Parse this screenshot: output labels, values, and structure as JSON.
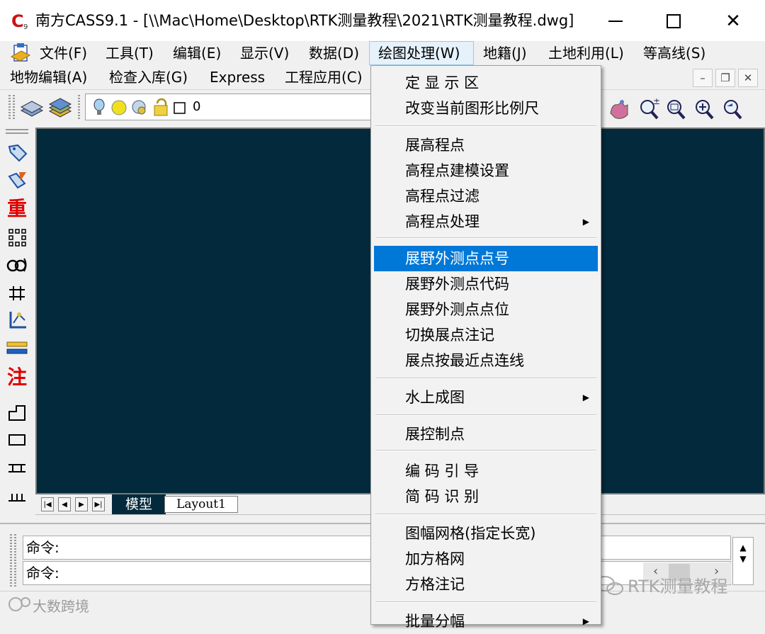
{
  "window": {
    "title": "南方CASS9.1 - [\\\\Mac\\Home\\Desktop\\RTK测量教程\\2021\\RTK测量教程.dwg]",
    "minimize": "—",
    "maximize": "☐",
    "close": "✕"
  },
  "menubar": {
    "row1": [
      "文件(F)",
      "工具(T)",
      "编辑(E)",
      "显示(V)",
      "数据(D)",
      "绘图处理(W)",
      "地籍(J)",
      "土地利用(L)",
      "等高线(S)"
    ],
    "row2": [
      "地物编辑(A)",
      "检查入库(G)",
      "Express",
      "工程应用(C)"
    ],
    "mdi": [
      "–",
      "❐",
      "✕"
    ]
  },
  "toolbar": {
    "layer": "0"
  },
  "lefttoolbar": {
    "char_zhong": "重",
    "char_zhu": "注"
  },
  "tabs": {
    "model": "模型",
    "layout1": "Layout1"
  },
  "command": {
    "line1": "命令:",
    "line2": "命令:"
  },
  "watermarks": {
    "left": "大数跨境",
    "right": "RTK测量教程"
  },
  "dropdown": {
    "items": [
      {
        "label": "定 显 示 区"
      },
      {
        "label": "改变当前图形比例尺"
      },
      {
        "label": "展高程点"
      },
      {
        "label": "高程点建模设置"
      },
      {
        "label": "高程点过滤"
      },
      {
        "label": "高程点处理",
        "submenu": true
      },
      {
        "label": "展野外测点点号",
        "highlighted": true
      },
      {
        "label": "展野外测点代码"
      },
      {
        "label": "展野外测点点位"
      },
      {
        "label": "切换展点注记"
      },
      {
        "label": "展点按最近点连线"
      },
      {
        "label": "水上成图",
        "submenu": true
      },
      {
        "label": "展控制点"
      },
      {
        "label": "编 码 引 导"
      },
      {
        "label": "简 码 识 别"
      },
      {
        "label": "图幅网格(指定长宽)"
      },
      {
        "label": "加方格网"
      },
      {
        "label": "方格注记"
      },
      {
        "label": "批量分幅",
        "submenu": true
      }
    ]
  },
  "colors": {
    "canvas": "#022a3c",
    "highlight": "#0078d7",
    "menu_bg": "#f2f2f2"
  }
}
